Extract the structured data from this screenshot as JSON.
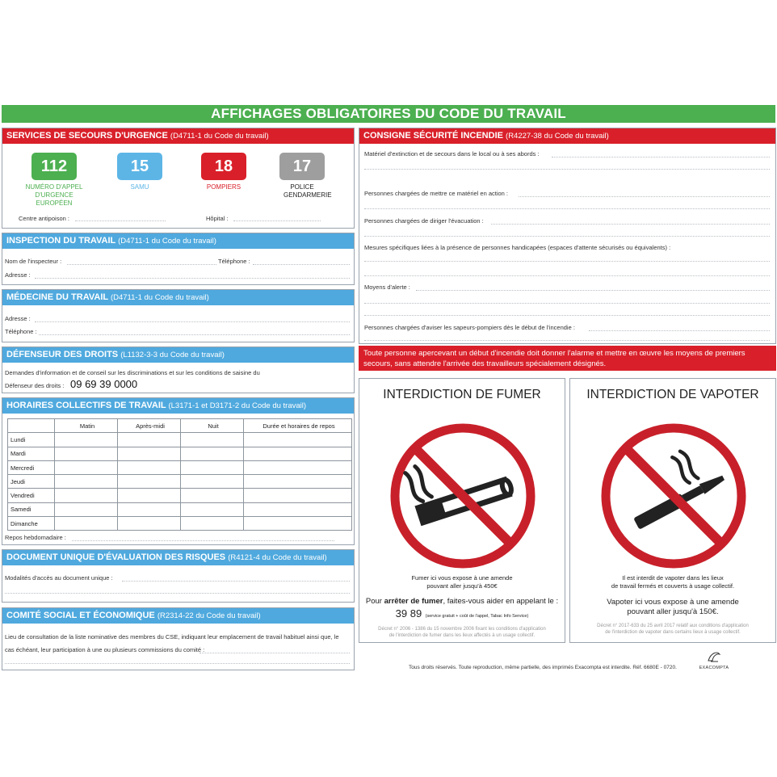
{
  "banner": "AFFICHAGES OBLIGATOIRES DU CODE DU TRAVAIL",
  "secours": {
    "title": "SERVICES DE SECOURS D'URGENCE",
    "ref": "(D4711-1 du Code du travail)",
    "numbers": [
      {
        "num": "112",
        "label": "NUMÉRO D'APPEL D'URGENCE EUROPÉEN",
        "color": "#4caf50"
      },
      {
        "num": "15",
        "label": "SAMU",
        "color": "#5db5e6"
      },
      {
        "num": "18",
        "label": "POMPIERS",
        "color": "#d9202a"
      },
      {
        "num": "17",
        "label": "POLICE GENDARMERIE",
        "color": "#9e9e9e"
      }
    ],
    "antipoison": "Centre antipoison :",
    "hopital": "Hôpital :"
  },
  "inspection": {
    "title": "INSPECTION DU TRAVAIL",
    "ref": "(D4711-1 du Code du travail)",
    "nom": "Nom de l'inspecteur :",
    "telephone": "Téléphone :",
    "adresse": "Adresse :"
  },
  "medecine": {
    "title": "MÉDECINE DU TRAVAIL",
    "ref": "(D4711-1 du Code du travail)",
    "adresse": "Adresse :",
    "telephone": "Téléphone :"
  },
  "defenseur": {
    "title": "DÉFENSEUR DES DROITS",
    "ref": "(L1132-3-3 du Code du travail)",
    "text": "Demandes d'information et de conseil sur les discriminations et sur les conditions de saisine du",
    "label": "Défenseur des droits :",
    "phone": "09 69 39 0000"
  },
  "horaires": {
    "title": "HORAIRES COLLECTIFS DE TRAVAIL",
    "ref": "(L3171-1 et D3171-2 du Code du travail)",
    "columns": [
      "Matin",
      "Après-midi",
      "Nuit",
      "Durée et horaires de repos"
    ],
    "days": [
      "Lundi",
      "Mardi",
      "Mercredi",
      "Jeudi",
      "Vendredi",
      "Samedi",
      "Dimanche"
    ],
    "repos": "Repos hebdomadaire :"
  },
  "document": {
    "title": "DOCUMENT UNIQUE D'ÉVALUATION DES RISQUES",
    "ref": "(R4121-4 du Code du travail)",
    "modalites": "Modalités d'accès au document unique :"
  },
  "cse": {
    "title": "COMITÉ SOCIAL ET ÉCONOMIQUE",
    "ref": "(R2314-22 du Code du travail)",
    "line1": "Lieu de consultation de la liste nominative des membres du CSE, indiquant leur emplacement de travail habituel ainsi que, le",
    "line2": "cas échéant, leur participation à une ou plusieurs commissions du comité :"
  },
  "incendie": {
    "title": "CONSIGNE SÉCURITÉ INCENDIE",
    "ref": "(R4227-38 du Code du travail)",
    "fields": [
      "Matériel d'extinction et de secours dans le local ou à ses abords :",
      "Personnes chargées de mettre ce matériel en action :",
      "Personnes chargées de diriger l'évacuation :",
      "Mesures spécifiques liées à la présence de personnes handicapées (espaces d'attente sécurisés ou équivalents) :",
      "Moyens d'alerte :",
      "Personnes chargées d'aviser les sapeurs-pompiers dès le début de l'incendie :"
    ],
    "alert": "Toute personne apercevant un début d'incendie doit donner l'alarme et mettre en œuvre les moyens de premiers secours, sans attendre l'arrivée des travailleurs spécialement désignés."
  },
  "fumer": {
    "title": "INTERDICTION DE FUMER",
    "amende1": "Fumer ici vous expose à une amende",
    "amende2": "pouvant aller jusqu'à 450€",
    "aide_pre": "Pour ",
    "aide_bold": "arrêter de fumer",
    "aide_post": ", faites-vous aider en appelant le :",
    "phone": "39 89",
    "phone_note": "(service gratuit + coût de l'appel, Tabac Info Service)",
    "decret1": "Décret n° 2006 - 1386 du 15 novembre 2006 fixant les conditions d'application",
    "decret2": "de l'interdiction de fumer dans les lieux affectés à un usage collectif."
  },
  "vapoter": {
    "title": "INTERDICTION DE VAPOTER",
    "text1": "Il est interdit de vapoter dans les lieux",
    "text2": "de travail fermés et couverts à usage collectif.",
    "amende1": "Vapoter ici vous expose à une amende",
    "amende2": "pouvant aller jusqu'à 150€.",
    "decret1": "Décret n° 2017-633 du 25 avril 2017 relatif aux conditions d'application",
    "decret2": "de l'interdiction de vapoter dans certains lieux à usage collectif."
  },
  "footer": "Tous droits réservés. Toute reproduction, même partielle, des imprimés Exacompta est interdite. Réf. 6680E - 0720.",
  "brand": "EXACOMPTA",
  "colors": {
    "red": "#d9202a",
    "blue": "#4fa9de",
    "green": "#4caf50"
  }
}
